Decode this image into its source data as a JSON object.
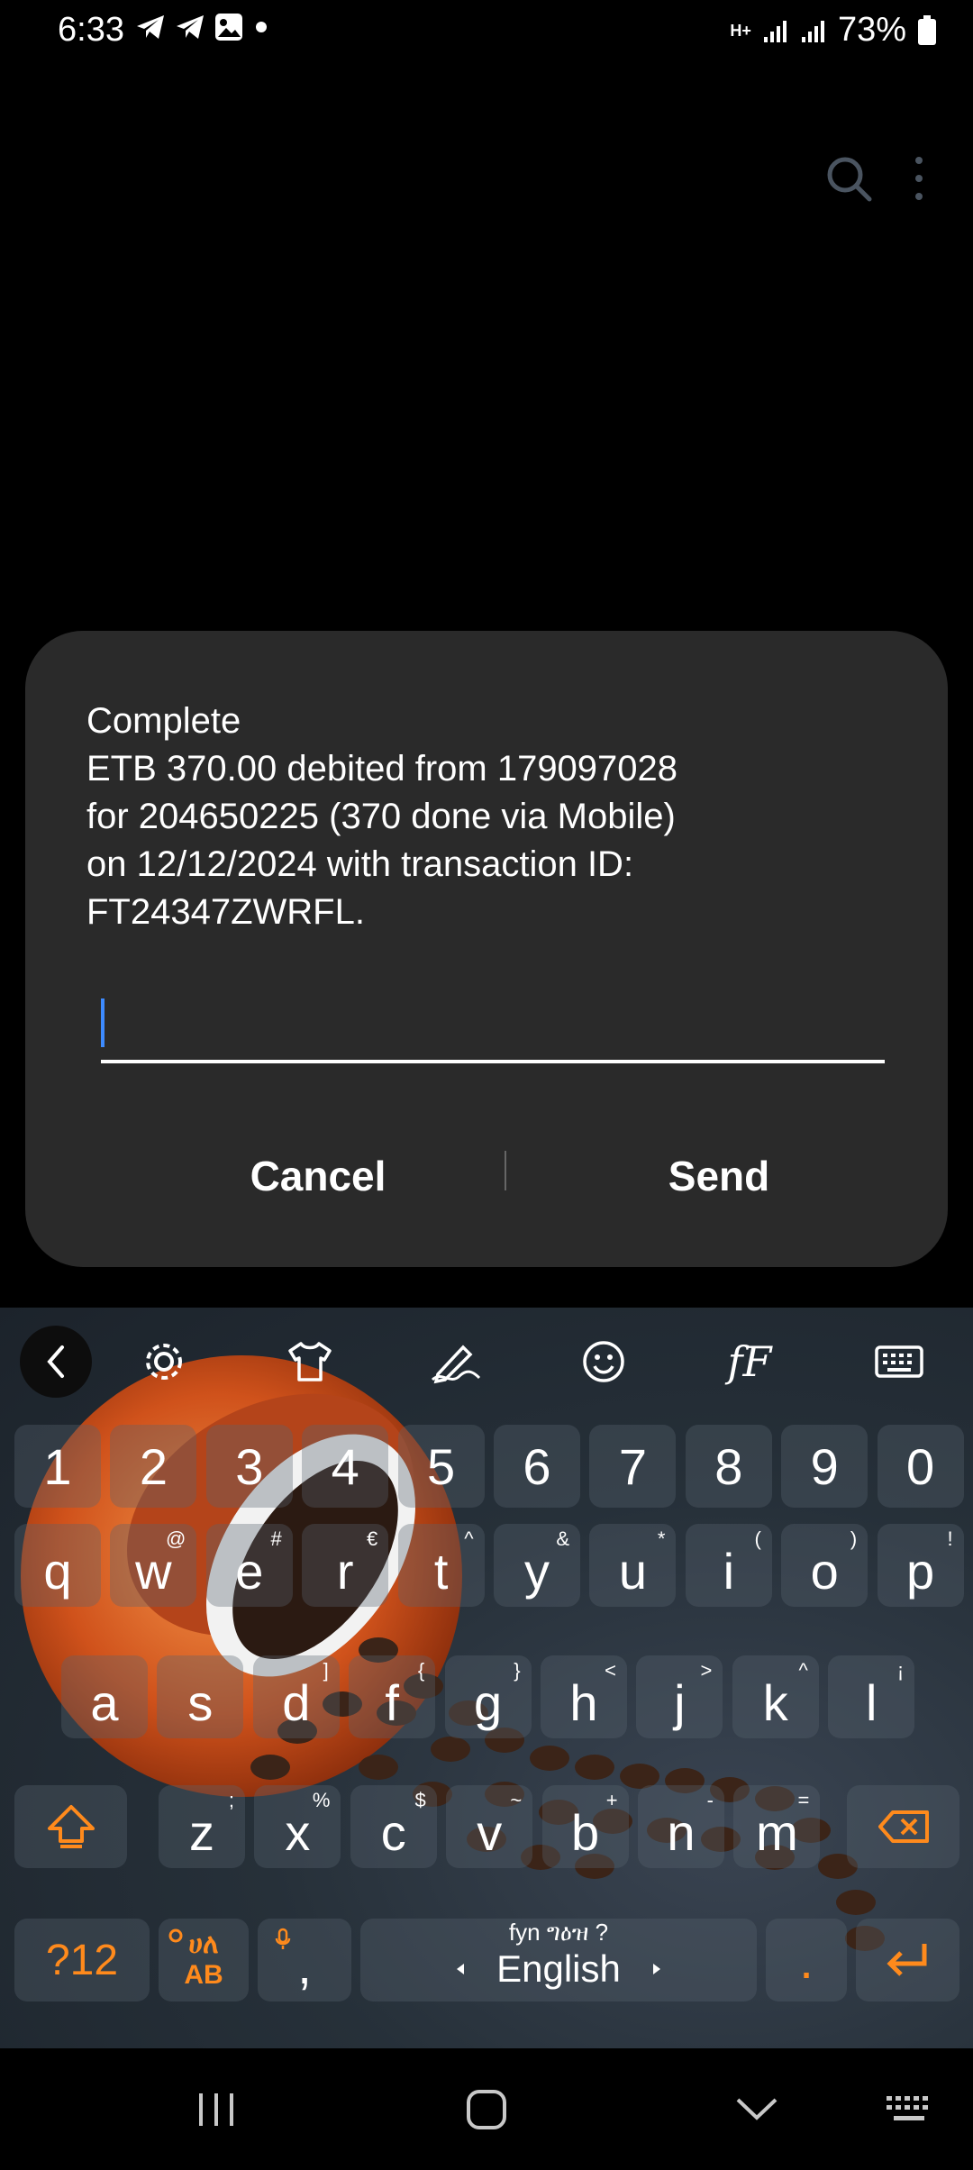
{
  "status_bar": {
    "time": "6:33",
    "network": "H+",
    "battery": "73%"
  },
  "dialog": {
    "message": "Complete\nETB 370.00 debited from 179097028\nfor 204650225 (370 done via Mobile)\non 12/12/2024 with transaction ID:\nFT24347ZWRFL.",
    "input_value": "",
    "cancel_label": "Cancel",
    "send_label": "Send"
  },
  "keyboard": {
    "toolbar": {
      "font_label": "fF"
    },
    "row_numbers": [
      "1",
      "2",
      "3",
      "4",
      "5",
      "6",
      "7",
      "8",
      "9",
      "0"
    ],
    "row1": [
      {
        "key": "q",
        "hint": ""
      },
      {
        "key": "w",
        "hint": "@"
      },
      {
        "key": "e",
        "hint": "#"
      },
      {
        "key": "r",
        "hint": "€"
      },
      {
        "key": "t",
        "hint": "^"
      },
      {
        "key": "y",
        "hint": "&"
      },
      {
        "key": "u",
        "hint": "*"
      },
      {
        "key": "i",
        "hint": "("
      },
      {
        "key": "o",
        "hint": ")"
      },
      {
        "key": "p",
        "hint": "!"
      }
    ],
    "row2": [
      {
        "key": "a",
        "hint": ""
      },
      {
        "key": "s",
        "hint": ""
      },
      {
        "key": "d",
        "hint": "]"
      },
      {
        "key": "f",
        "hint": "{"
      },
      {
        "key": "g",
        "hint": "}"
      },
      {
        "key": "h",
        "hint": "<"
      },
      {
        "key": "j",
        "hint": ">"
      },
      {
        "key": "k",
        "hint": "^"
      },
      {
        "key": "l",
        "hint": "¡"
      }
    ],
    "row3": [
      {
        "key": "z",
        "hint": ";"
      },
      {
        "key": "x",
        "hint": "%"
      },
      {
        "key": "c",
        "hint": "$"
      },
      {
        "key": "v",
        "hint": "~"
      },
      {
        "key": "b",
        "hint": "+"
      },
      {
        "key": "n",
        "hint": "-"
      },
      {
        "key": "m",
        "hint": "="
      }
    ],
    "symbols_label": "?12",
    "lang_switch_top": "ሀለ",
    "lang_switch_bottom": "AB",
    "comma": ",",
    "space_label": "English",
    "space_hint": "fyn ግዕዝ ?",
    "period": ".",
    "colors": {
      "accent": "#ff8a1c",
      "key_bg": "#5a6470"
    }
  }
}
